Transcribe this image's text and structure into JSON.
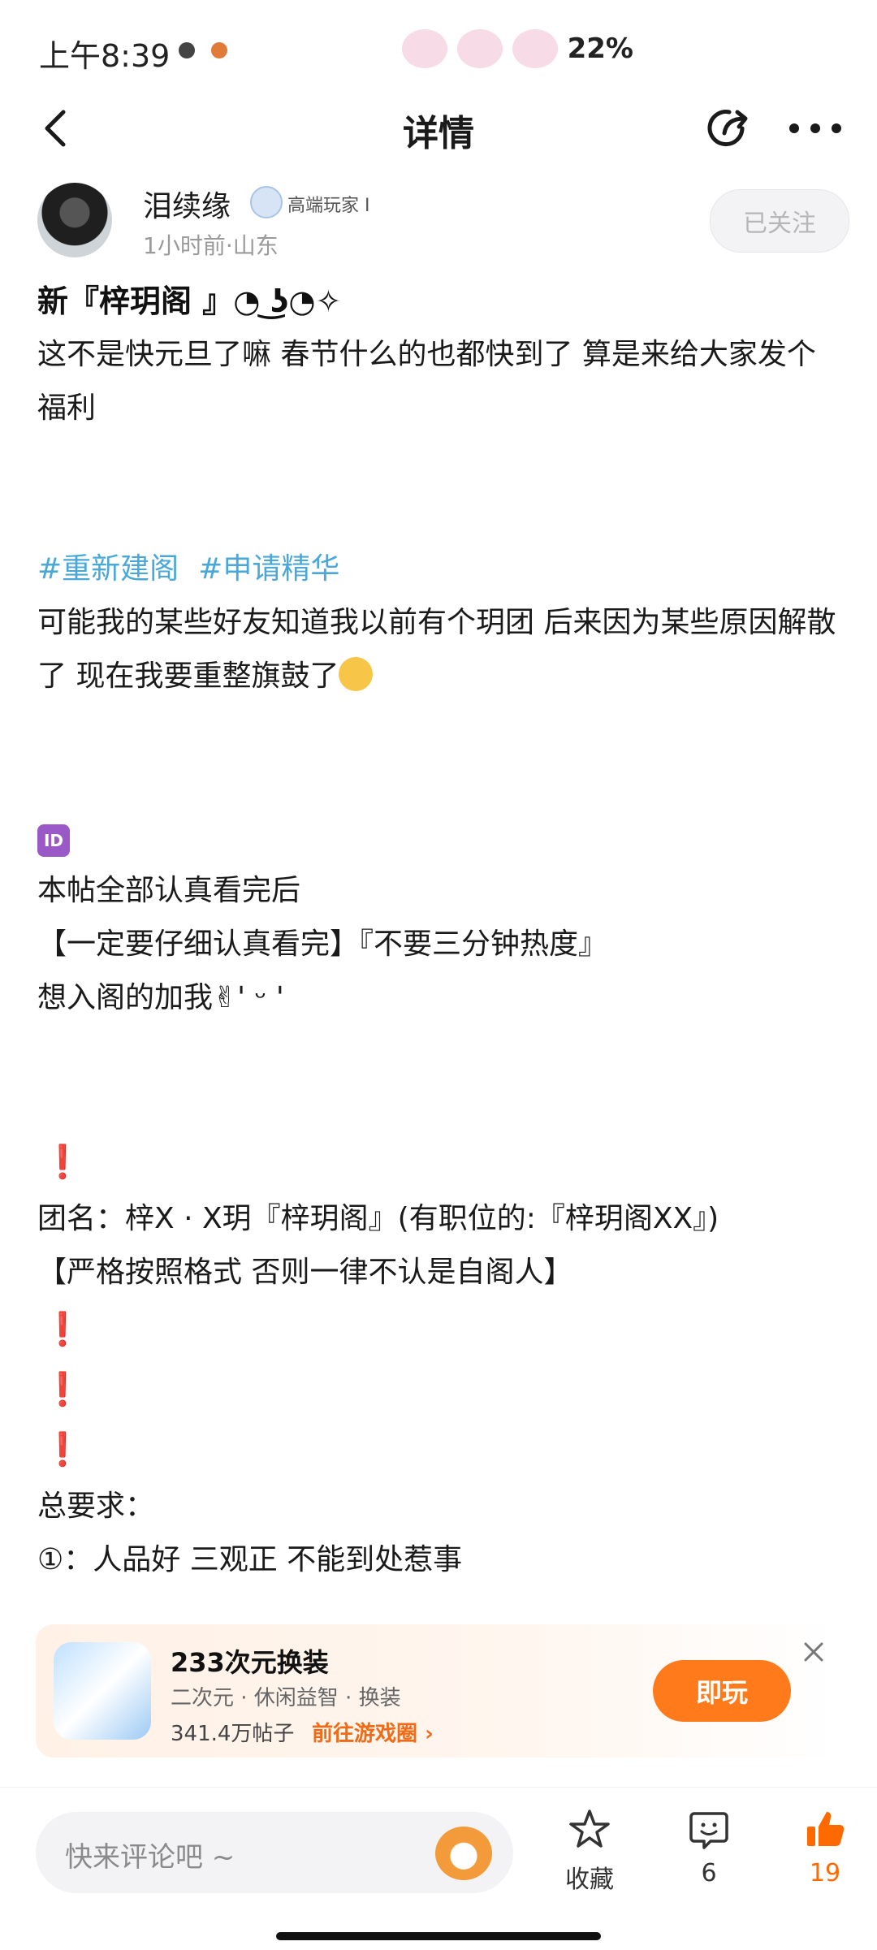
{
  "status_bar": {
    "time": "上午8:39",
    "battery": "22%"
  },
  "nav": {
    "title": "详情"
  },
  "author": {
    "name": "泪续缘",
    "badge": "高端玩家 I",
    "meta": "1小时前·山东",
    "follow_label": "已关注"
  },
  "post": {
    "title": "新『梓玥阁 』◔ ͜ʖ◔✧",
    "para1": "这不是快元旦了嘛  春节什么的也都快到了  算是来给大家发个福利",
    "tags": [
      "#重新建阁",
      "#申请精华"
    ],
    "para2": "可能我的某些好友知道我以前有个玥团  后来因为某些原因解散了  现在我要重整旗鼓了",
    "id_label": "ID",
    "line_read": "本帖全部认真看完后",
    "line_careful": "【一定要仔细认真看完】『不要三分钟热度』",
    "line_join": "想入阁的加我✌︎' ᵕ '",
    "excl": "❗",
    "line_team": "团名：梓X · X玥『梓玥阁』(有职位的:『梓玥阁XX』)",
    "line_strict": "【严格按照格式  否则一律不认是自阁人】",
    "line_req": "总要求：",
    "line_req1": "①：人品好  三观正  不能到处惹事"
  },
  "ad": {
    "title": "233次元换装",
    "tags": "二次元 · 休闲益智 · 换装",
    "posts": "341.4万帖子",
    "link": "前往游戏圈",
    "play_label": "即玩"
  },
  "bottom_bar": {
    "comment_placeholder": "快来评论吧 ~",
    "fav_label": "收藏",
    "comment_count": "6",
    "like_count": "19"
  },
  "colors": {
    "accent": "#ff7a1a",
    "tag": "#4aa8d8",
    "excl": "#e02424"
  }
}
